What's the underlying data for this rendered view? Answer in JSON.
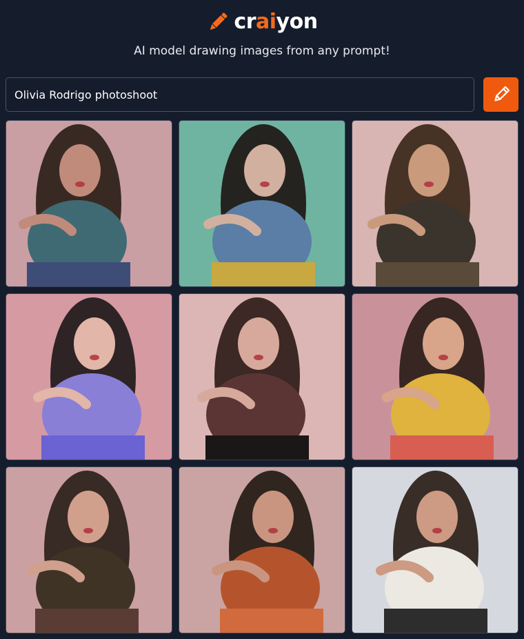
{
  "header": {
    "logo_icon": "pencil-icon",
    "logo_text_pre": "cr",
    "logo_text_accent": "ai",
    "logo_text_post": "yon",
    "tagline": "AI model drawing images from any prompt!"
  },
  "prompt": {
    "value": "Olivia Rodrigo photoshoot",
    "button_icon": "pencil-icon"
  },
  "colors": {
    "background": "#151c2c",
    "accent": "#f05a0e",
    "logo_accent": "#f36b1c"
  },
  "results": [
    {
      "bg": "#c99fa3",
      "hair": "#2c1e18",
      "skin": "#c08b7a",
      "top": "#3f6a73",
      "bottom": "#3e4d78"
    },
    {
      "bg": "#6fb4a0",
      "hair": "#1e1713",
      "skin": "#d2b09f",
      "top": "#5a7ea6",
      "bottom": "#c8a840"
    },
    {
      "bg": "#d8b4b3",
      "hair": "#3a2819",
      "skin": "#c99a7c",
      "top": "#3b342c",
      "bottom": "#5a4a3a"
    },
    {
      "bg": "#d69aa3",
      "hair": "#1f1a1a",
      "skin": "#e2b6a8",
      "top": "#8a7fd6",
      "bottom": "#6b62d3"
    },
    {
      "bg": "#dcb6b4",
      "hair": "#2e1c18",
      "skin": "#d7a99c",
      "top": "#5b3534",
      "bottom": "#1b1716"
    },
    {
      "bg": "#c9929b",
      "hair": "#2a1d17",
      "skin": "#d8a48a",
      "top": "#e0b23e",
      "bottom": "#d85e52"
    },
    {
      "bg": "#caa0a2",
      "hair": "#2b1f1a",
      "skin": "#d0a08c",
      "top": "#3f3326",
      "bottom": "#5a3c34"
    },
    {
      "bg": "#c9a4a3",
      "hair": "#241a14",
      "skin": "#c99580",
      "top": "#b5542c",
      "bottom": "#d16b3d"
    },
    {
      "bg": "#d5d9df",
      "hair": "#2a1e17",
      "skin": "#cd9a83",
      "top": "#ece8e2",
      "bottom": "#2d2d2d"
    }
  ]
}
